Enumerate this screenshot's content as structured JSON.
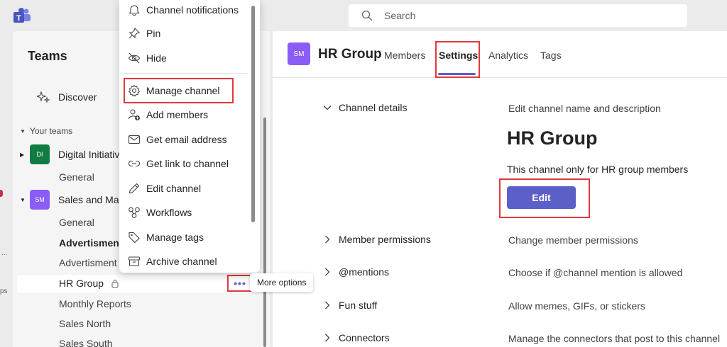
{
  "search": {
    "placeholder": "Search"
  },
  "left_panel": {
    "title": "Teams",
    "discover_label": "Discover",
    "section_label": "Your teams",
    "teams": [
      {
        "initials": "DI",
        "name": "Digital Initiativ",
        "color": "#107c41"
      },
      {
        "initials": "SM",
        "name": "Sales and Mar",
        "color": "#8b5cf6"
      }
    ],
    "channels": {
      "di_general": "General",
      "sm_general": "General",
      "advertisment_bold": "Advertisment",
      "advertisment": "Advertisment",
      "hr_group": "HR Group",
      "monthly_reports": "Monthly Reports",
      "sales_north": "Sales North",
      "sales_south": "Sales South"
    },
    "more_options_glyph": "•••",
    "tooltip": "More options"
  },
  "rail": {
    "dots": "...",
    "apps": "ps"
  },
  "context_menu": {
    "items": [
      {
        "label": "Channel notifications",
        "icon": "bell-icon"
      },
      {
        "label": "Pin",
        "icon": "pin-icon"
      },
      {
        "label": "Hide",
        "icon": "eye-off-icon"
      },
      {
        "label": "Manage channel",
        "icon": "gear-icon"
      },
      {
        "label": "Add members",
        "icon": "add-person-icon"
      },
      {
        "label": "Get email address",
        "icon": "mail-icon"
      },
      {
        "label": "Get link to channel",
        "icon": "link-icon"
      },
      {
        "label": "Edit channel",
        "icon": "pencil-icon"
      },
      {
        "label": "Workflows",
        "icon": "workflow-icon"
      },
      {
        "label": "Manage tags",
        "icon": "tag-icon"
      },
      {
        "label": "Archive channel",
        "icon": "archive-icon"
      }
    ]
  },
  "channel_header": {
    "initials": "SM",
    "name": "HR Group",
    "tabs": [
      "Members",
      "Settings",
      "Analytics",
      "Tags"
    ],
    "active_tab": "Settings"
  },
  "settings": {
    "channel_details": {
      "label": "Channel details",
      "description": "Edit channel name and description",
      "channel_name": "HR Group",
      "channel_description": "This channel only for HR group members",
      "edit_label": "Edit"
    },
    "rows": [
      {
        "label": "Member permissions",
        "description": "Change member permissions"
      },
      {
        "label": "@mentions",
        "description": "Choose if @channel mention is allowed"
      },
      {
        "label": "Fun stuff",
        "description": "Allow memes, GIFs, or stickers"
      },
      {
        "label": "Connectors",
        "description": "Manage the connectors that post to this channel"
      }
    ]
  },
  "colors": {
    "accent": "#5b5fc7",
    "highlight": "#e0393e"
  }
}
